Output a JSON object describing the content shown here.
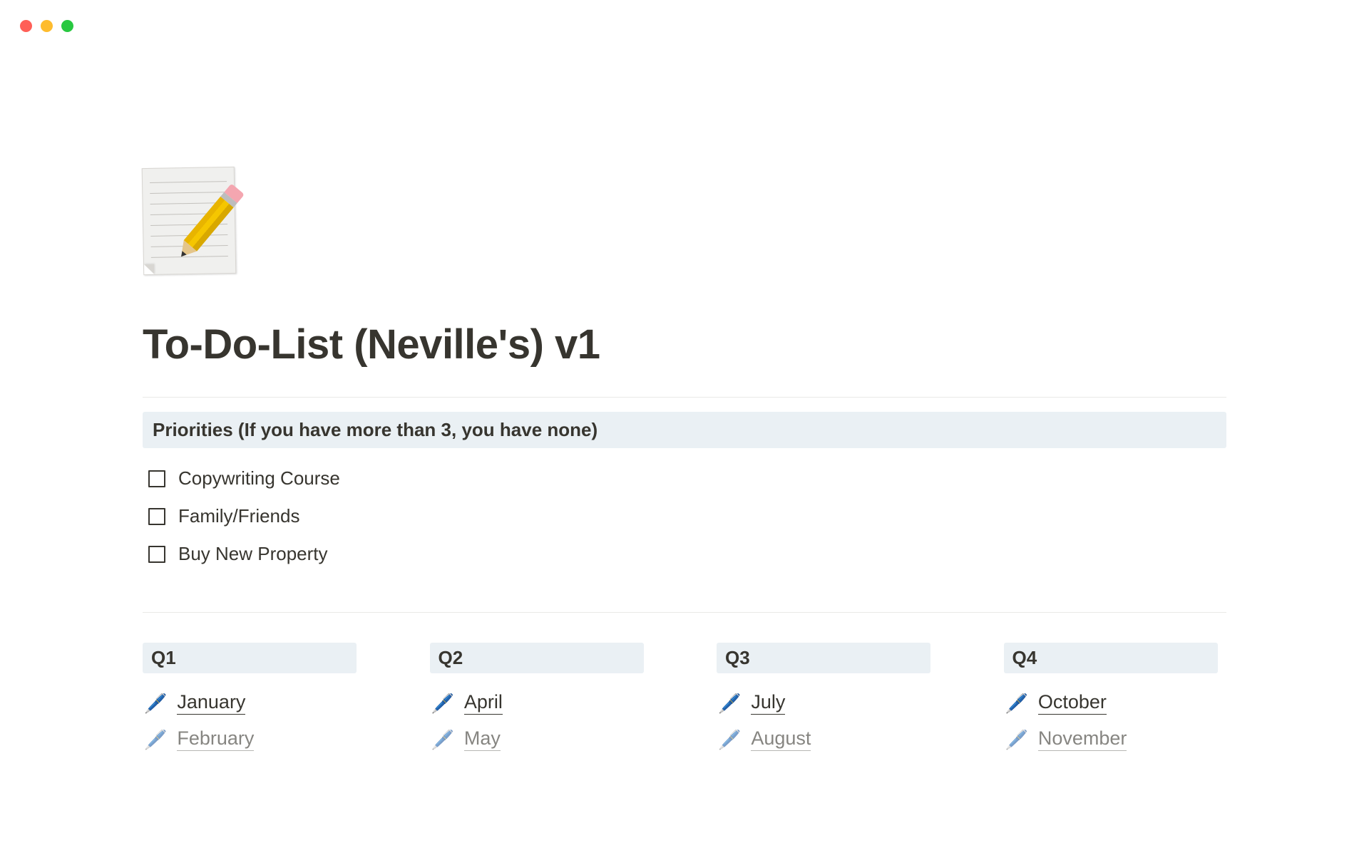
{
  "page": {
    "title": "To-Do-List (Neville's) v1",
    "icon": "memo-pencil"
  },
  "priorities": {
    "heading": "Priorities (If you have more than 3, you have none)",
    "items": [
      {
        "label": "Copywriting Course",
        "checked": false
      },
      {
        "label": "Family/Friends",
        "checked": false
      },
      {
        "label": "Buy New Property",
        "checked": false
      }
    ]
  },
  "quarters": [
    {
      "label": "Q1",
      "months": [
        {
          "label": "January",
          "icon": "pen-icon",
          "fully_visible": true
        },
        {
          "label": "February",
          "icon": "pen-icon",
          "fully_visible": false
        }
      ]
    },
    {
      "label": "Q2",
      "months": [
        {
          "label": "April",
          "icon": "pen-icon",
          "fully_visible": true
        },
        {
          "label": "May",
          "icon": "pen-icon",
          "fully_visible": false
        }
      ]
    },
    {
      "label": "Q3",
      "months": [
        {
          "label": "July",
          "icon": "pen-icon",
          "fully_visible": true
        },
        {
          "label": "August",
          "icon": "pen-icon",
          "fully_visible": false
        }
      ]
    },
    {
      "label": "Q4",
      "months": [
        {
          "label": "October",
          "icon": "pen-icon",
          "fully_visible": true
        },
        {
          "label": "November",
          "icon": "pen-icon",
          "fully_visible": false
        }
      ]
    }
  ]
}
